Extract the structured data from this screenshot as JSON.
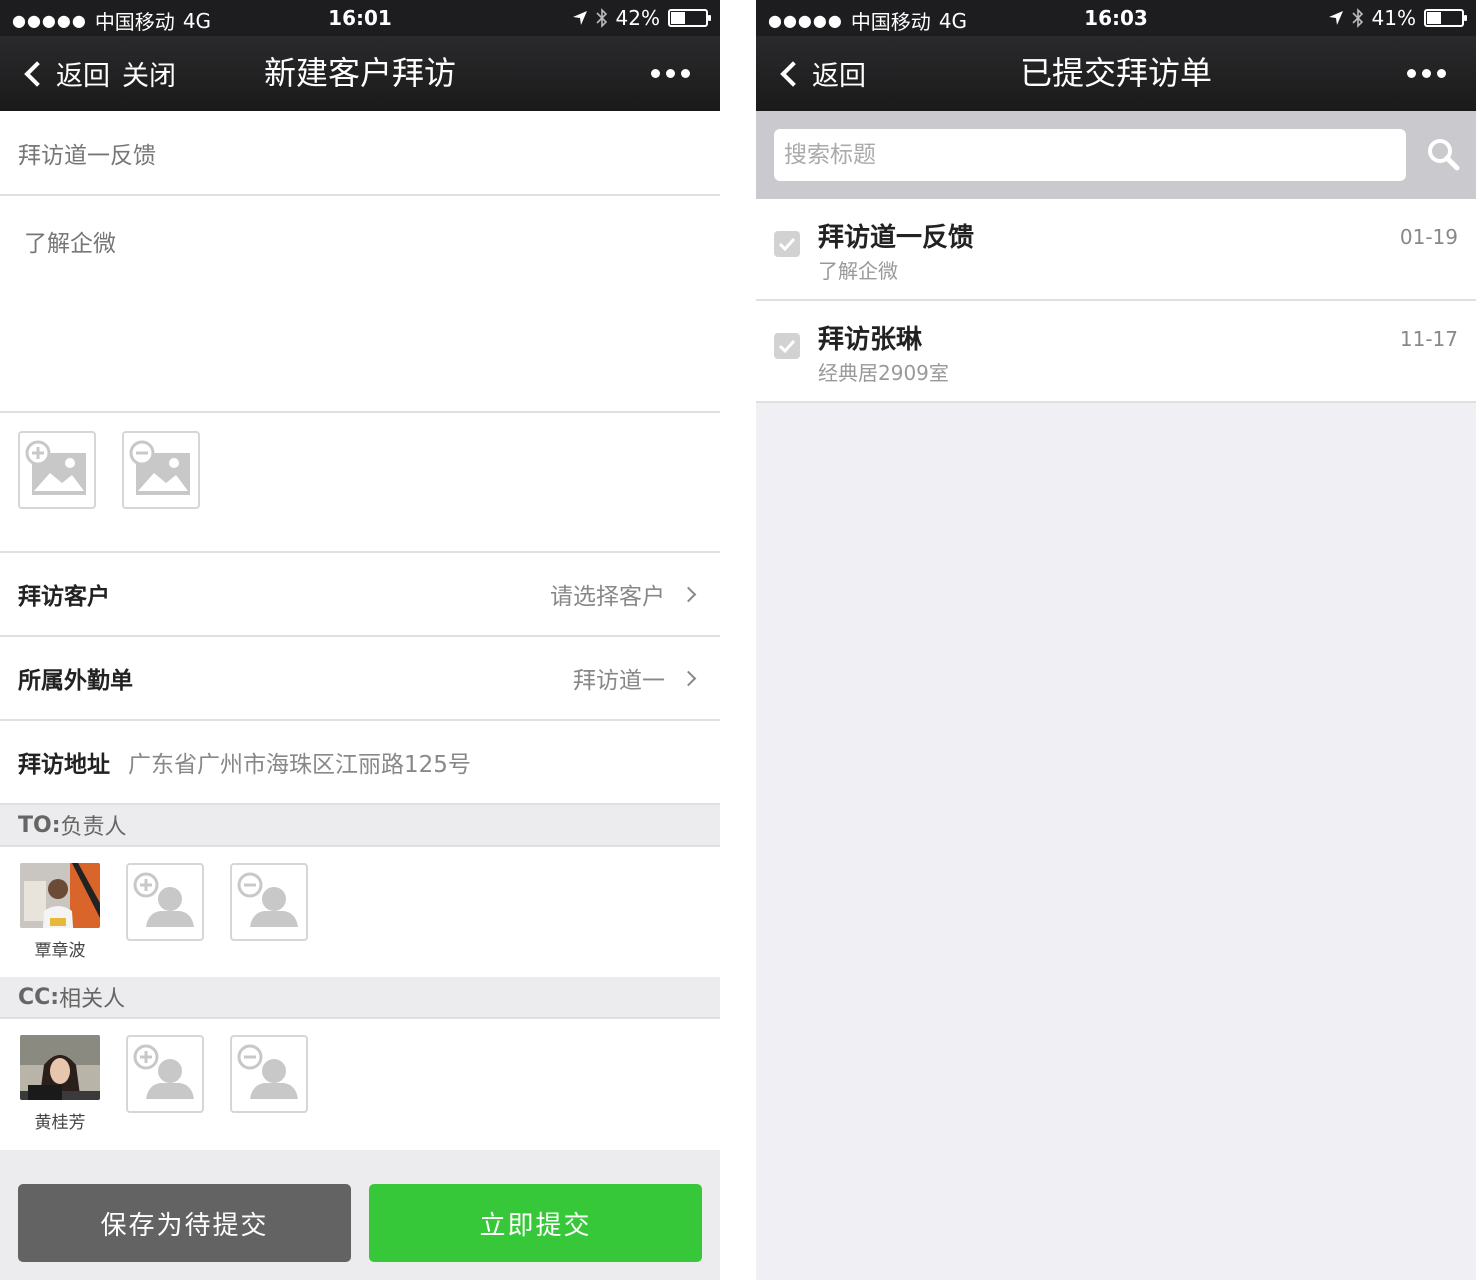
{
  "left_screen": {
    "status_bar": {
      "carrier": "中国移动",
      "network": "4G",
      "time": "16:01",
      "battery": "42%",
      "battery_level": 0.42
    },
    "nav": {
      "back_label": "返回",
      "close_label": "关闭",
      "title": "新建客户拜访"
    },
    "form": {
      "title_value": "拜访道一反馈",
      "content_value": "了解企微",
      "customer_label": "拜访客户",
      "customer_value": "请选择客户",
      "attendance_label": "所属外勤单",
      "attendance_value": "拜访道一",
      "address_label": "拜访地址",
      "address_value": "广东省广州市海珠区江丽路125号"
    },
    "to_section": {
      "prefix": "TO:",
      "label": "负责人",
      "people": [
        {
          "name": "覃章波"
        }
      ]
    },
    "cc_section": {
      "prefix": "CC:",
      "label": "相关人",
      "people": [
        {
          "name": "黄桂芳"
        }
      ]
    },
    "buttons": {
      "save_label": "保存为待提交",
      "submit_label": "立即提交"
    }
  },
  "right_screen": {
    "status_bar": {
      "carrier": "中国移动",
      "network": "4G",
      "time": "16:03",
      "battery": "41%",
      "battery_level": 0.41
    },
    "nav": {
      "back_label": "返回",
      "title": "已提交拜访单"
    },
    "search": {
      "placeholder": "搜索标题"
    },
    "items": [
      {
        "title": "拜访道一反馈",
        "subtitle": "了解企微",
        "date": "01-19"
      },
      {
        "title": "拜访张琳",
        "subtitle": "经典居2909室",
        "date": "11-17"
      }
    ]
  },
  "colors": {
    "nav_bg": "#1d1d1f",
    "submit_green": "#37c83a",
    "save_gray": "#636363",
    "section_bg": "#ececee"
  },
  "icons": [
    "back-chevron-icon",
    "more-icon",
    "add-image-icon",
    "remove-image-icon",
    "add-person-icon",
    "remove-person-icon",
    "search-icon",
    "checkbox-icon",
    "chevron-right-icon",
    "location-arrow-icon",
    "bluetooth-icon",
    "battery-icon"
  ]
}
